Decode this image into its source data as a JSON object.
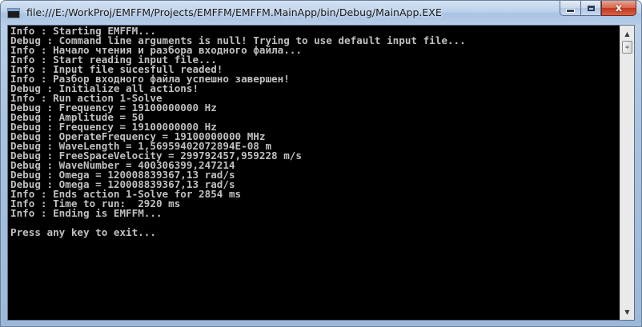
{
  "window": {
    "title": "file:///E:/WorkProj/EMFFM/Projects/EMFFM/EMFFM.MainApp/bin/Debug/MainApp.EXE",
    "icon": "console-app-icon",
    "buttons": {
      "minimize_icon": "minimize-icon",
      "maximize_icon": "maximize-icon",
      "close_glyph": "x"
    }
  },
  "console": {
    "background": "#000000",
    "foreground": "#c0c0c0",
    "lines": [
      "Info : Starting EMFFM...",
      "Debug : Command line arguments is null! Trying to use default input file...",
      "Info : Начало чтения и разбора входного файла...",
      "Info : Start reading input file...",
      "Info : Input file sucesfull readed!",
      "Info : Разбор входного файла успешно завершен!",
      "Debug : Initialize all actions!",
      "Info : Run action 1-Solve",
      "Debug : Frequency = 19100000000 Hz",
      "Debug : Amplitude = 50",
      "Debug : Frequency = 19100000000 Hz",
      "Debug : OperateFrequency = 19100000000 MHz",
      "Debug : WaveLength = 1,56959402072894E-08 m",
      "Debug : FreeSpaceVelocity = 299792457,959228 m/s",
      "Debug : WaveNumber = 400306399,247214",
      "Debug : Omega = 120008839367,13 rad/s",
      "Debug : Omega = 120008839367,13 rad/s",
      "Info : Ends action 1-Solve for 2854 ms",
      "Info : Time to run:  2920 ms",
      "Info : Ending is EMFFM...",
      "",
      "Press any key to exit..."
    ]
  },
  "scrollbar": {
    "up_arrow": "▲",
    "down_arrow": "▼",
    "thumb_grip": "≑"
  }
}
